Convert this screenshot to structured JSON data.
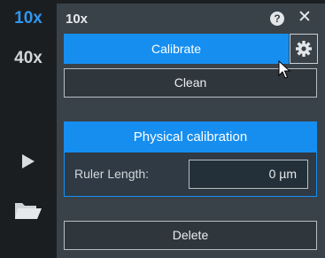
{
  "objectives": {
    "items": [
      {
        "label": "10x",
        "active": true
      },
      {
        "label": "40x",
        "active": false
      }
    ]
  },
  "sidebar": {
    "play_icon": "play-icon",
    "folder_icon": "folder-icon"
  },
  "panel": {
    "title": "10x",
    "help_glyph": "?",
    "close_glyph": "✕"
  },
  "buttons": {
    "calibrate": "Calibrate",
    "clean": "Clean",
    "delete": "Delete",
    "settings_icon": "gear-icon"
  },
  "physical_calibration": {
    "header": "Physical calibration",
    "ruler_label": "Ruler Length:",
    "ruler_value": "0 µm"
  },
  "colors": {
    "accent": "#168ef0",
    "active_objective": "#2f97f0",
    "panel_bg": "#3a4249",
    "rail_bg": "#1b1e21"
  }
}
